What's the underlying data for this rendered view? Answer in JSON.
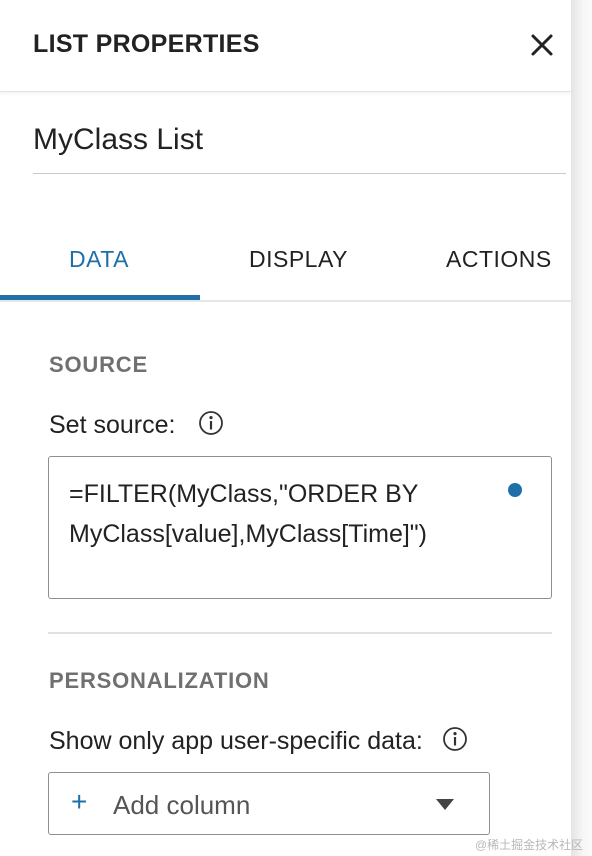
{
  "header": {
    "title": "LIST PROPERTIES",
    "close_icon": "close-icon"
  },
  "list_name": "MyClass List",
  "tabs": [
    {
      "label": "DATA",
      "active": true
    },
    {
      "label": "DISPLAY",
      "active": false
    },
    {
      "label": "ACTIONS",
      "active": false
    }
  ],
  "source_section": {
    "heading": "SOURCE",
    "label": "Set source:",
    "info_icon": "info-icon",
    "formula": "=FILTER(MyClass,\"ORDER BY MyClass[value],MyClass[Time]\")",
    "status_dot_color": "#1f6fa8"
  },
  "personalization_section": {
    "heading": "PERSONALIZATION",
    "label": "Show only app user-specific data:",
    "info_icon": "info-icon",
    "select_placeholder": "Add column",
    "plus_icon": "plus-icon",
    "dropdown_icon": "caret-down-icon"
  },
  "colors": {
    "accent": "#1f6fa8",
    "heading_gray": "#707070",
    "border": "#8f8f8f"
  },
  "watermark": "@稀土掘金技术社区"
}
